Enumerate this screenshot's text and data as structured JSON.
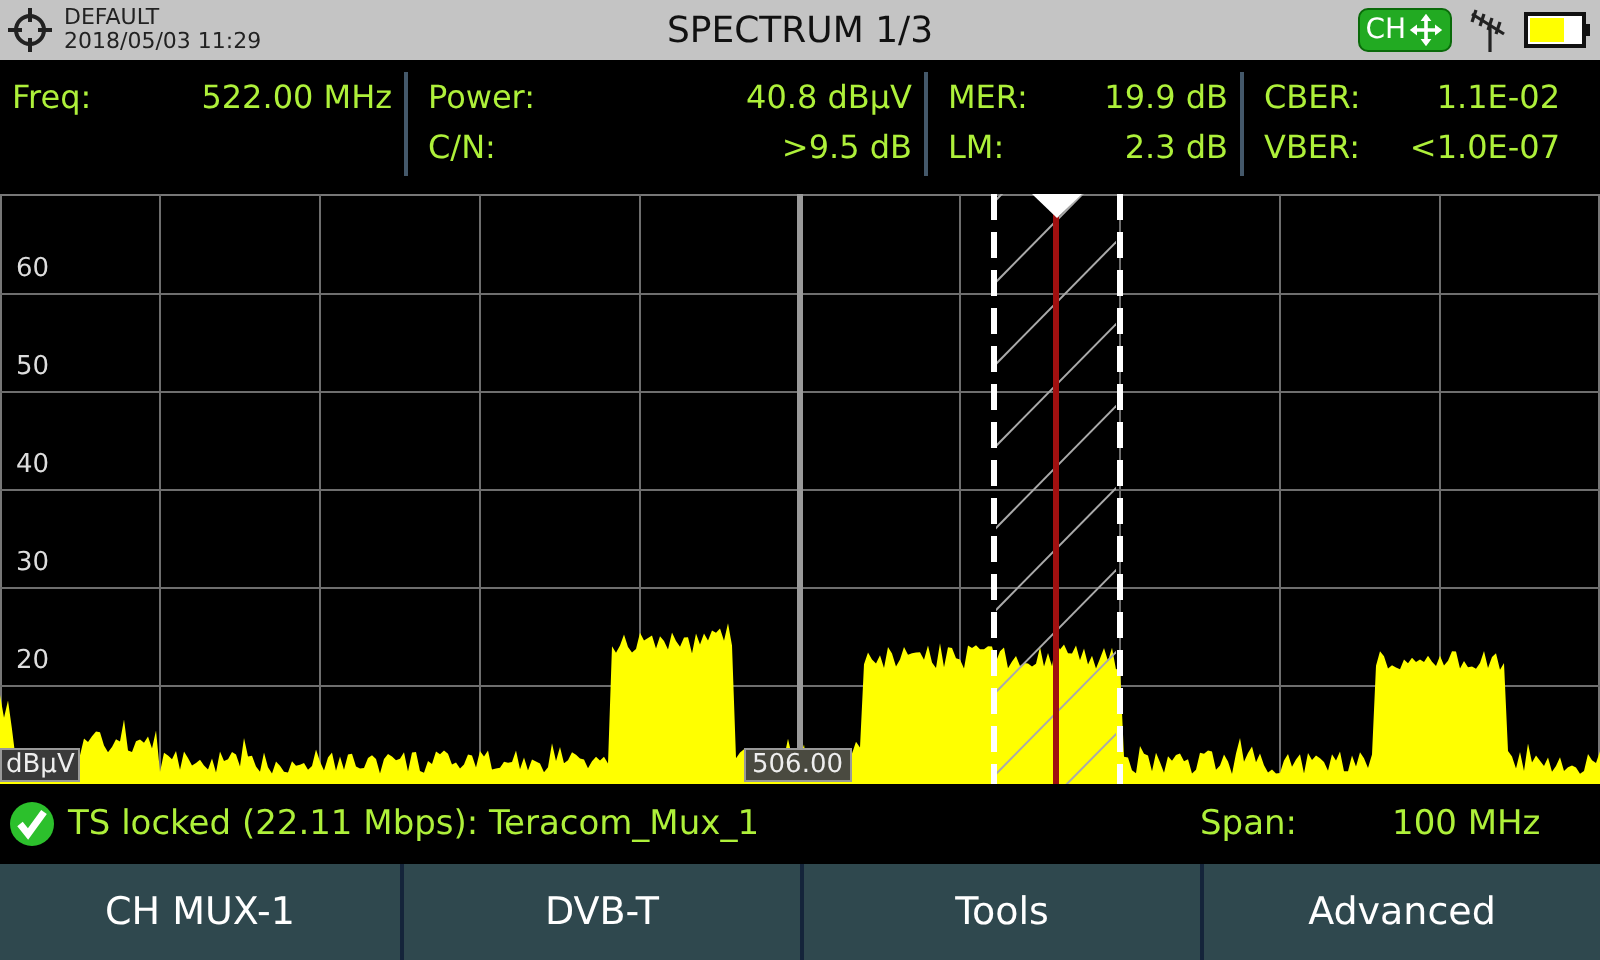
{
  "header": {
    "profile": "DEFAULT",
    "datetime": "2018/05/03 11:29",
    "title": "SPECTRUM 1/3",
    "badge": "CH"
  },
  "measurements": [
    [
      {
        "label": "Freq:",
        "value": "522.00 MHz"
      }
    ],
    [
      {
        "label": "Power:",
        "value": "40.8 dBµV"
      },
      {
        "label": "C/N:",
        "value": ">9.5 dB"
      }
    ],
    [
      {
        "label": "MER:",
        "value": "19.9 dB"
      },
      {
        "label": "LM:",
        "value": "2.3 dB"
      }
    ],
    [
      {
        "label": "CBER:",
        "value": "1.1E-02"
      },
      {
        "label": "VBER:",
        "value": "<1.0E-07"
      }
    ]
  ],
  "spectrum": {
    "y_labels": [
      "60",
      "50",
      "40",
      "30",
      "20"
    ],
    "unit": "dBµV",
    "center_marker": "506.00"
  },
  "status": {
    "locked": true,
    "text": "TS locked (22.11 Mbps): Teracom_Mux_1",
    "span_label": "Span:",
    "span_value": "100 MHz"
  },
  "softkeys": [
    "CH MUX-1",
    "DVB-T",
    "Tools",
    "Advanced"
  ]
}
